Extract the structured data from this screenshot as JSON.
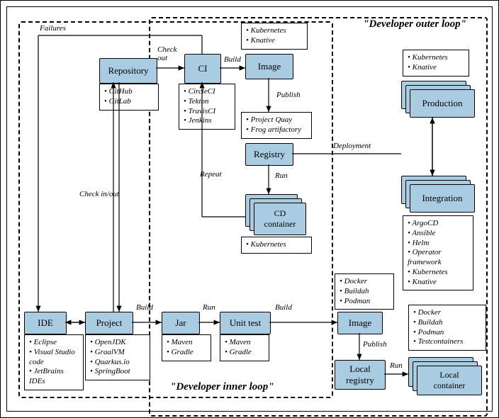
{
  "loops": {
    "outer_title": "\"Developer outer loop\"",
    "inner_title": "\"Developer inner loop\""
  },
  "nodes": {
    "ide": "IDE",
    "project": "Project",
    "jar": "Jar",
    "unit_test": "Unit test",
    "repository": "Repository",
    "ci": "CI",
    "image_outer": "Image",
    "registry": "Registry",
    "cd_container": "CD\ncontainer",
    "production": "Production",
    "integration": "Integration",
    "image_inner": "Image",
    "local_registry": "Local\nregistry",
    "local_container": "Local\ncontainer"
  },
  "edges": {
    "failures": "Failures",
    "check_in_out": "Check in/out",
    "check_out": "Check\nout",
    "build1": "Build",
    "build2": "Build",
    "build3": "Build",
    "run1": "Run",
    "run2": "Run",
    "run3": "Run",
    "publish1": "Publish",
    "publish2": "Publish",
    "repeat": "Repeat",
    "deployment": "Deployment"
  },
  "notes": {
    "ide": [
      "Eclipse",
      "Visual Studio code",
      "JetBrains IDEs"
    ],
    "project": [
      "OpenJDK",
      "GraalVM",
      "Quarkus.io",
      "SpringBoot"
    ],
    "jar": [
      "Maven",
      "Gradle"
    ],
    "unit_test": [
      "Maven",
      "Gradle"
    ],
    "repository": [
      "GitHub",
      "GitLab"
    ],
    "ci": [
      "CircleCI",
      "Tekton",
      "TravisCI",
      "Jenkins"
    ],
    "image_outer_top": [
      "Kubernetes",
      "Knative"
    ],
    "registry_top": [
      "Project Quay",
      "Frog artifactory"
    ],
    "cd_container": [
      "Kubernetes"
    ],
    "production_top": [
      "Kubernetes",
      "Knative"
    ],
    "integration": [
      "ArgoCD",
      "Ansible",
      "Helm",
      "Operator framework",
      "Kubernetes",
      "Knative"
    ],
    "image_inner_top": [
      "Docker",
      "Buildah",
      "Podman"
    ],
    "local_container_top": [
      "Docker",
      "Buildah",
      "Podman",
      "Testcontainers"
    ]
  }
}
